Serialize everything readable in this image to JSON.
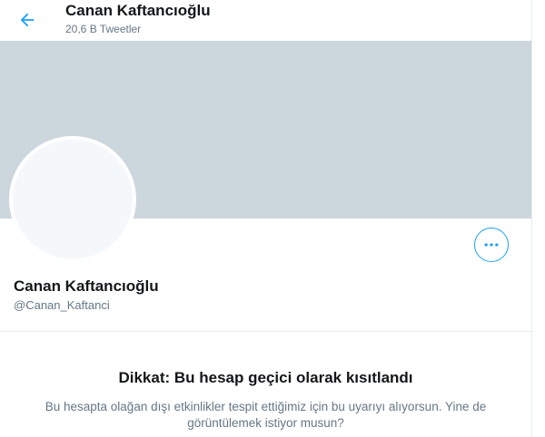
{
  "header": {
    "title": "Canan Kaftancıoğlu",
    "subtitle": "20,6 B Tweetler",
    "back_icon": "arrow-left-icon"
  },
  "profile": {
    "name": "Canan Kaftancıoğlu",
    "handle": "@Canan_Kaftanci",
    "more_icon": "more-horizontal-icon"
  },
  "warning": {
    "title": "Dikkat: Bu hesap geçici olarak kısıtlandı",
    "text": "Bu hesapta olağan dışı etkinlikler tespit ettiğimiz için bu uyarıyı alıyorsun. Yine de görüntülemek istiyor musun?"
  },
  "colors": {
    "accent": "#1da1f2",
    "banner": "#ccd6dd",
    "avatar": "#f5f8fa",
    "secondary_text": "#657786"
  }
}
